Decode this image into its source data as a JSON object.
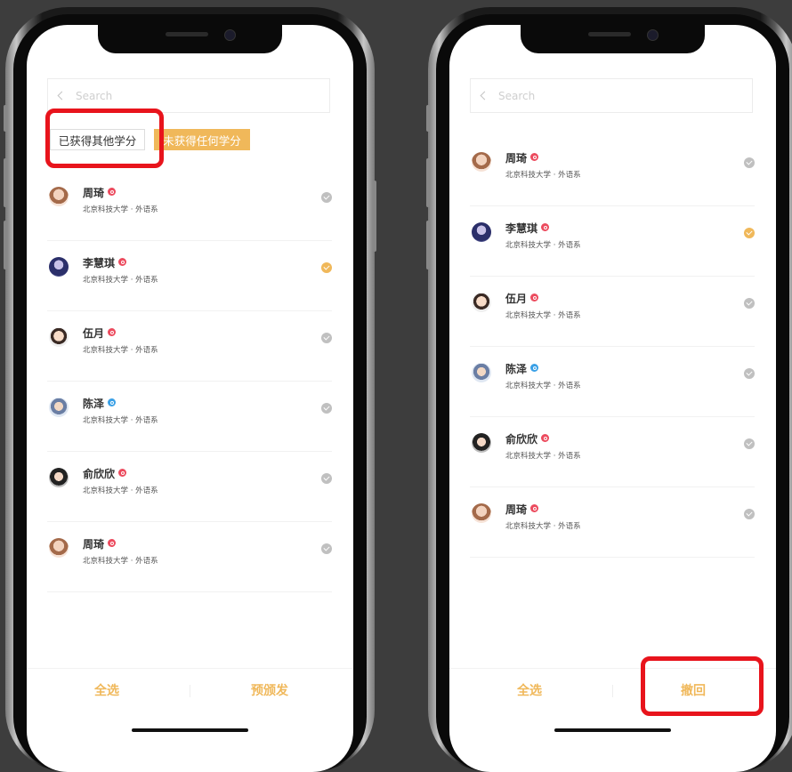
{
  "left_screen": {
    "search": {
      "placeholder": "Search"
    },
    "tabs": [
      {
        "label": "已获得其他学分",
        "active": true
      },
      {
        "label": "未获得任何学分",
        "active": false
      }
    ],
    "students": [
      {
        "name": "周琦",
        "gender": "female",
        "school": "北京科技大学 · 外语系",
        "selected": false
      },
      {
        "name": "李慧琪",
        "gender": "female",
        "school": "北京科技大学 · 外语系",
        "selected": true
      },
      {
        "name": "伍月",
        "gender": "female",
        "school": "北京科技大学 · 外语系",
        "selected": false
      },
      {
        "name": "陈泽",
        "gender": "male",
        "school": "北京科技大学 · 外语系",
        "selected": false
      },
      {
        "name": "俞欣欣",
        "gender": "female",
        "school": "北京科技大学 · 外语系",
        "selected": false
      },
      {
        "name": "周琦",
        "gender": "female",
        "school": "北京科技大学 · 外语系",
        "selected": false
      }
    ],
    "bottom_bar": {
      "select_all": "全选",
      "action": "预颁发"
    }
  },
  "right_screen": {
    "search": {
      "placeholder": "Search"
    },
    "students": [
      {
        "name": "周琦",
        "gender": "female",
        "school": "北京科技大学 · 外语系",
        "selected": false
      },
      {
        "name": "李慧琪",
        "gender": "female",
        "school": "北京科技大学 · 外语系",
        "selected": true
      },
      {
        "name": "伍月",
        "gender": "female",
        "school": "北京科技大学 · 外语系",
        "selected": false
      },
      {
        "name": "陈泽",
        "gender": "male",
        "school": "北京科技大学 · 外语系",
        "selected": false
      },
      {
        "name": "俞欣欣",
        "gender": "female",
        "school": "北京科技大学 · 外语系",
        "selected": false
      },
      {
        "name": "周琦",
        "gender": "female",
        "school": "北京科技大学 · 外语系",
        "selected": false
      }
    ],
    "bottom_bar": {
      "select_all": "全选",
      "action": "撤回"
    }
  },
  "colors": {
    "accent": "#f0b85a",
    "female": "#ec4b5e",
    "male": "#3aa0e6",
    "check_off": "#c0c0c0",
    "highlight": "#e8141c",
    "background": "#3d3d3d"
  },
  "icons": [
    "back-chevron-icon",
    "female-icon",
    "male-icon",
    "check-circle-icon"
  ]
}
